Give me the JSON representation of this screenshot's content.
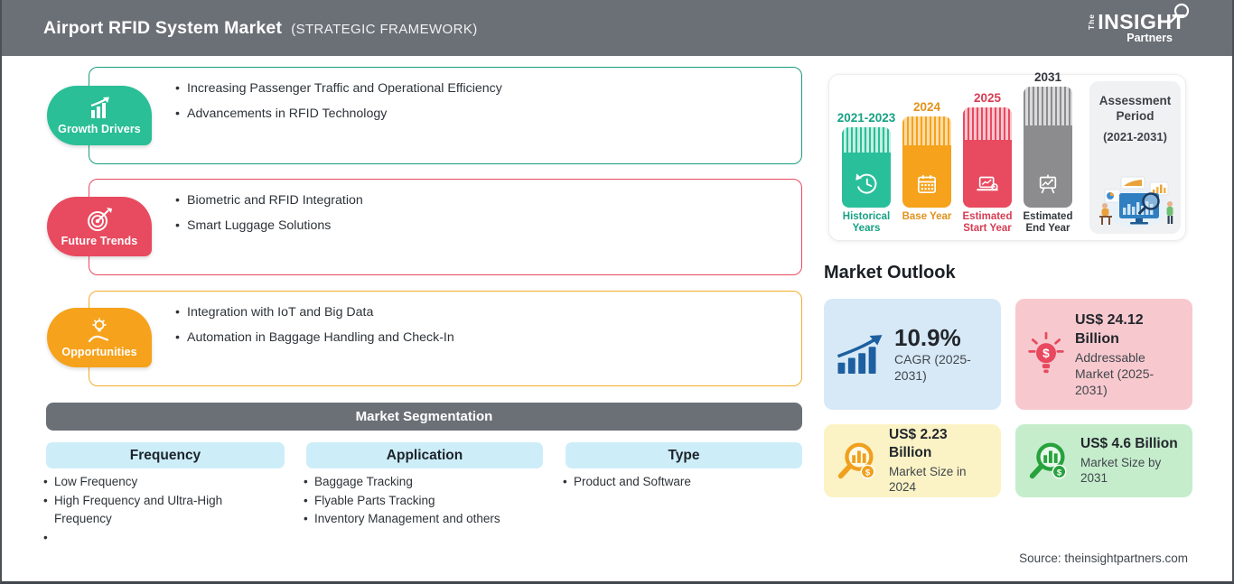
{
  "header": {
    "title": "Airport RFID System Market",
    "subtitle": "(STRATEGIC FRAMEWORK)",
    "logo": {
      "the": "The",
      "insight": "INSIGHT",
      "partners": "Partners"
    }
  },
  "framework": [
    {
      "label": "Growth Drivers",
      "color": "#2abf96",
      "border": "#1a9c7c",
      "items": [
        "Increasing Passenger Traffic and Operational Efficiency",
        "Advancements in RFID Technology"
      ]
    },
    {
      "label": "Future Trends",
      "color": "#e84a5f",
      "border": "#e84a5f",
      "items": [
        "Biometric and RFID Integration",
        "Smart Luggage Solutions"
      ]
    },
    {
      "label": "Opportunities",
      "color": "#f6a21c",
      "border": "#f0ad2b",
      "items": [
        "Integration with IoT and Big Data",
        "Automation in Baggage Handling and Check-In"
      ]
    }
  ],
  "segmentation": {
    "title": "Market Segmentation",
    "columns": [
      {
        "header": "Frequency",
        "items": [
          "Low Frequency",
          "High Frequency and Ultra-High Frequency",
          ""
        ]
      },
      {
        "header": "Application",
        "items": [
          "Baggage Tracking",
          "Flyable Parts Tracking",
          "Inventory Management and others"
        ]
      },
      {
        "header": "Type",
        "items": [
          "Product and Software"
        ]
      }
    ]
  },
  "timeline": {
    "bars": [
      {
        "year": "2021-2023",
        "label": "Historical Years",
        "color": "#2abf9b",
        "tint": "#c4efe1",
        "text": "#16a184"
      },
      {
        "year": "2024",
        "label": "Base Year",
        "color": "#f6a21c",
        "tint": "#fcdca6",
        "text": "#e0921a"
      },
      {
        "year": "2025",
        "label": "Estimated Start Year",
        "color": "#e84a5f",
        "tint": "#f8c5cd",
        "text": "#d63c53"
      },
      {
        "year": "2031",
        "label": "Estimated End Year",
        "color": "#8c8c8e",
        "tint": "#dadadc",
        "text": "#34383d"
      }
    ],
    "assessment": {
      "line1": "Assessment",
      "line2": "Period",
      "line3": "(2021-2031)"
    }
  },
  "market_outlook": {
    "heading": "Market Outlook",
    "cards": [
      {
        "title": "10.9%",
        "sub": "CAGR (2025-2031)",
        "bg": "#d7e9f6",
        "accent": "#1d5fa0"
      },
      {
        "title": "US$ 24.12 Billion",
        "sub": "Addressable Market (2025-2031)",
        "bg": "#f7c9ce",
        "accent": "#e8495f"
      },
      {
        "title": "US$ 2.23 Billion",
        "sub": "Market Size in 2024",
        "bg": "#fbf3c5",
        "accent": "#f0a01e"
      },
      {
        "title": "US$ 4.6 Billion",
        "sub": "Market Size by 2031",
        "bg": "#c5edcc",
        "accent": "#27a23c"
      }
    ]
  },
  "source": "Source: theinsightpartners.com"
}
